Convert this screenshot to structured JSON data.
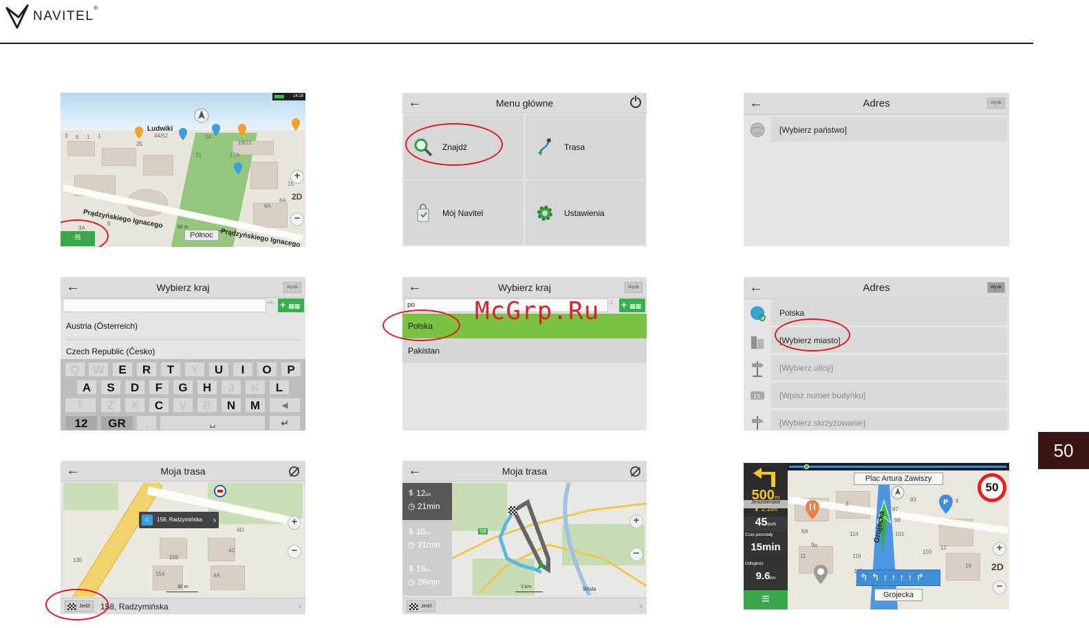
{
  "header": {
    "brand": "NAVITEL",
    "brand_reg": "®",
    "page_number": "50"
  },
  "watermark": "McGrp.Ru",
  "screen1": {
    "status_time": "14:15",
    "street_name": "Ludwiki",
    "street_bottom_1": "Prądzyńskiego Ignacego",
    "street_bottom_2": "Prądzyńskiego Ignacego",
    "scale": "50 m",
    "north_label": "Północ",
    "view_mode": "2D",
    "numbers": [
      "25",
      "44/52",
      "24",
      "19/21",
      "17A",
      "31",
      "15",
      "8A",
      "6A",
      "3A",
      "9",
      "3",
      "6",
      "1",
      "1"
    ]
  },
  "screen2": {
    "title": "Menu główne",
    "items": [
      "Znajdź",
      "Trasa",
      "Mój Navitel",
      "Ustawienia"
    ]
  },
  "screen3": {
    "title": "Adres",
    "result_button": "Wynik",
    "row": "[Wybierz państwo]"
  },
  "screen4": {
    "title": "Wybierz kraj",
    "result_button": "Wynik",
    "search_counter": "+8",
    "items": [
      "Austria (Österreich)",
      "Czech Republic (Česko)"
    ],
    "keyboard": {
      "row1": [
        "Q",
        "W",
        "E",
        "R",
        "T",
        "Y",
        "U",
        "I",
        "O",
        "P"
      ],
      "row2": [
        "A",
        "S",
        "D",
        "F",
        "G",
        "H",
        "J",
        "K",
        "L"
      ],
      "row3": [
        "⇧",
        "Z",
        "X",
        "C",
        "V",
        "B",
        "N",
        "M",
        "◀"
      ],
      "row4_left": "12",
      "row4_lang": "GR",
      "row4_dot": ".",
      "row4_space": "␣",
      "row4_enter": "↵"
    }
  },
  "screen5": {
    "title": "Wybierz kraj",
    "result_button": "Wynik",
    "search_value": "po",
    "search_counter": "2",
    "items": [
      "Polska",
      "Pakistan"
    ]
  },
  "screen6": {
    "title": "Adres",
    "result_button": "Wynik",
    "rows": [
      "Polska",
      "[Wybierz miasto]",
      "[Wybierz ulicę]",
      "[Wpisz numer budynku]",
      "[Wybierz skrzyżowanie]"
    ]
  },
  "screen7": {
    "title": "Moja trasa",
    "popup": "158, Radzymińska",
    "go_button": "Jedź!",
    "address": "158, Radzymińska",
    "scale": "30 m",
    "numbers": [
      "4D",
      "4C",
      "4A",
      "156",
      "154",
      "135"
    ]
  },
  "screen8": {
    "title": "Moja trasa",
    "go_button": "Jedź!",
    "scale": "3 km",
    "place": "Wisła",
    "road_label": "S8",
    "routes": [
      {
        "distance": "12",
        "unit": "km",
        "time": "21min"
      },
      {
        "distance": "10",
        "unit": "km",
        "time": "21min"
      },
      {
        "distance": "16",
        "unit": "km",
        "time": "26min"
      }
    ]
  },
  "screen9": {
    "turn_distance": "500",
    "turn_unit": "m",
    "street_small": "Jerozolimskie",
    "next_distance": "2.2",
    "next_unit": "km",
    "speed": "45",
    "speed_unit": "km/h",
    "remaining_label": "Czas pozostały",
    "remaining_time": "15min",
    "distance_label": "Odległość",
    "distance_value": "9.6",
    "distance_unit": "km",
    "top_street": "Plac Artura Zawiszy",
    "bottom_street": "Grojecka",
    "side_street": "Grojecka",
    "speed_limit": "50",
    "view_mode": "2D",
    "numbers": [
      "93",
      "97",
      "99",
      "101",
      "103",
      "114",
      "116",
      "118",
      "120",
      "6A",
      "9a",
      "3",
      "11",
      "12",
      "14",
      "8"
    ],
    "colors": {
      "accent_green": "#38a848",
      "route_blue": "#3b8de0",
      "speed_red": "#e0231f"
    }
  }
}
